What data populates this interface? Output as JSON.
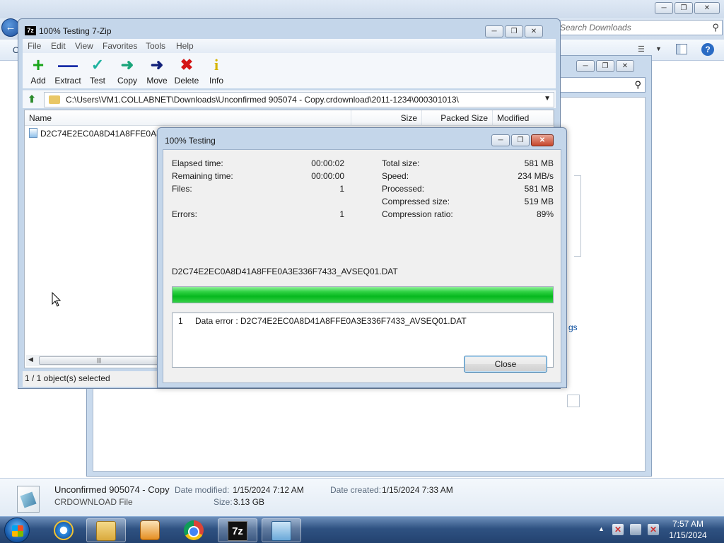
{
  "explorer": {
    "search_placeholder": "Search Downloads",
    "cmd_partial": "O",
    "details": {
      "name": "Unconfirmed 905074 - Copy",
      "type": "CRDOWNLOAD File",
      "modified_label": "Date modified:",
      "modified_value": "1/15/2024 7:12 AM",
      "created_label": "Date created:",
      "created_value": "1/15/2024 7:33 AM",
      "size_label": "Size:",
      "size_value": "3.13 GB"
    }
  },
  "second_window": {
    "link_fragment": "gs"
  },
  "zip": {
    "title": "100% Testing 7-Zip",
    "logo": "7z",
    "menu": [
      "File",
      "Edit",
      "View",
      "Favorites",
      "Tools",
      "Help"
    ],
    "toolbar": [
      {
        "label": "Add",
        "icon": "plus-icon",
        "color": "#1aa51a"
      },
      {
        "label": "Extract",
        "icon": "minus-icon",
        "color": "#1a2fa8"
      },
      {
        "label": "Test",
        "icon": "checkmark-icon",
        "color": "#1fb3a0"
      },
      {
        "label": "Copy",
        "icon": "arrow-right-icon",
        "color": "#1aa57a"
      },
      {
        "label": "Move",
        "icon": "arrow-right-icon",
        "color": "#12217a"
      },
      {
        "label": "Delete",
        "icon": "x-icon",
        "color": "#d41414"
      },
      {
        "label": "Info",
        "icon": "info-icon",
        "color": "#d6b400"
      }
    ],
    "path": "C:\\Users\\VM1.COLLABNET\\Downloads\\Unconfirmed 905074 - Copy.crdownload\\2011-1234\\000301013\\",
    "columns": [
      "Name",
      "Size",
      "Packed Size",
      "Modified"
    ],
    "file_name": "D2C74E2EC0A8D41A8FFE0A3E3",
    "status": "1 / 1 object(s) selected"
  },
  "dialog": {
    "title": "100% Testing",
    "stats_left": [
      {
        "label": "Elapsed time:",
        "value": "00:00:02"
      },
      {
        "label": "Remaining time:",
        "value": "00:00:00"
      },
      {
        "label": "Files:",
        "value": "1"
      },
      {
        "label": "Errors:",
        "value": "1"
      }
    ],
    "stats_right": [
      {
        "label": "Total size:",
        "value": "581 MB"
      },
      {
        "label": "Speed:",
        "value": "234 MB/s"
      },
      {
        "label": "Processed:",
        "value": "581 MB"
      },
      {
        "label": "Compressed size:",
        "value": "519 MB"
      },
      {
        "label": "Compression ratio:",
        "value": "89%"
      }
    ],
    "current_file": "D2C74E2EC0A8D41A8FFE0A3E336F7433_AVSEQ01.DAT",
    "progress_percent": 100,
    "messages": [
      {
        "num": "1",
        "text": "Data error : D2C74E2EC0A8D41A8FFE0A3E336F7433_AVSEQ01.DAT"
      }
    ],
    "close_label": "Close"
  },
  "taskbar": {
    "zip_icon_text": "7z",
    "time": "7:57 AM",
    "date": "1/15/2024"
  },
  "colors": {
    "progress": "#06b81e",
    "title_bar": "#c4d6ea",
    "taskbar": "#2f5282"
  }
}
